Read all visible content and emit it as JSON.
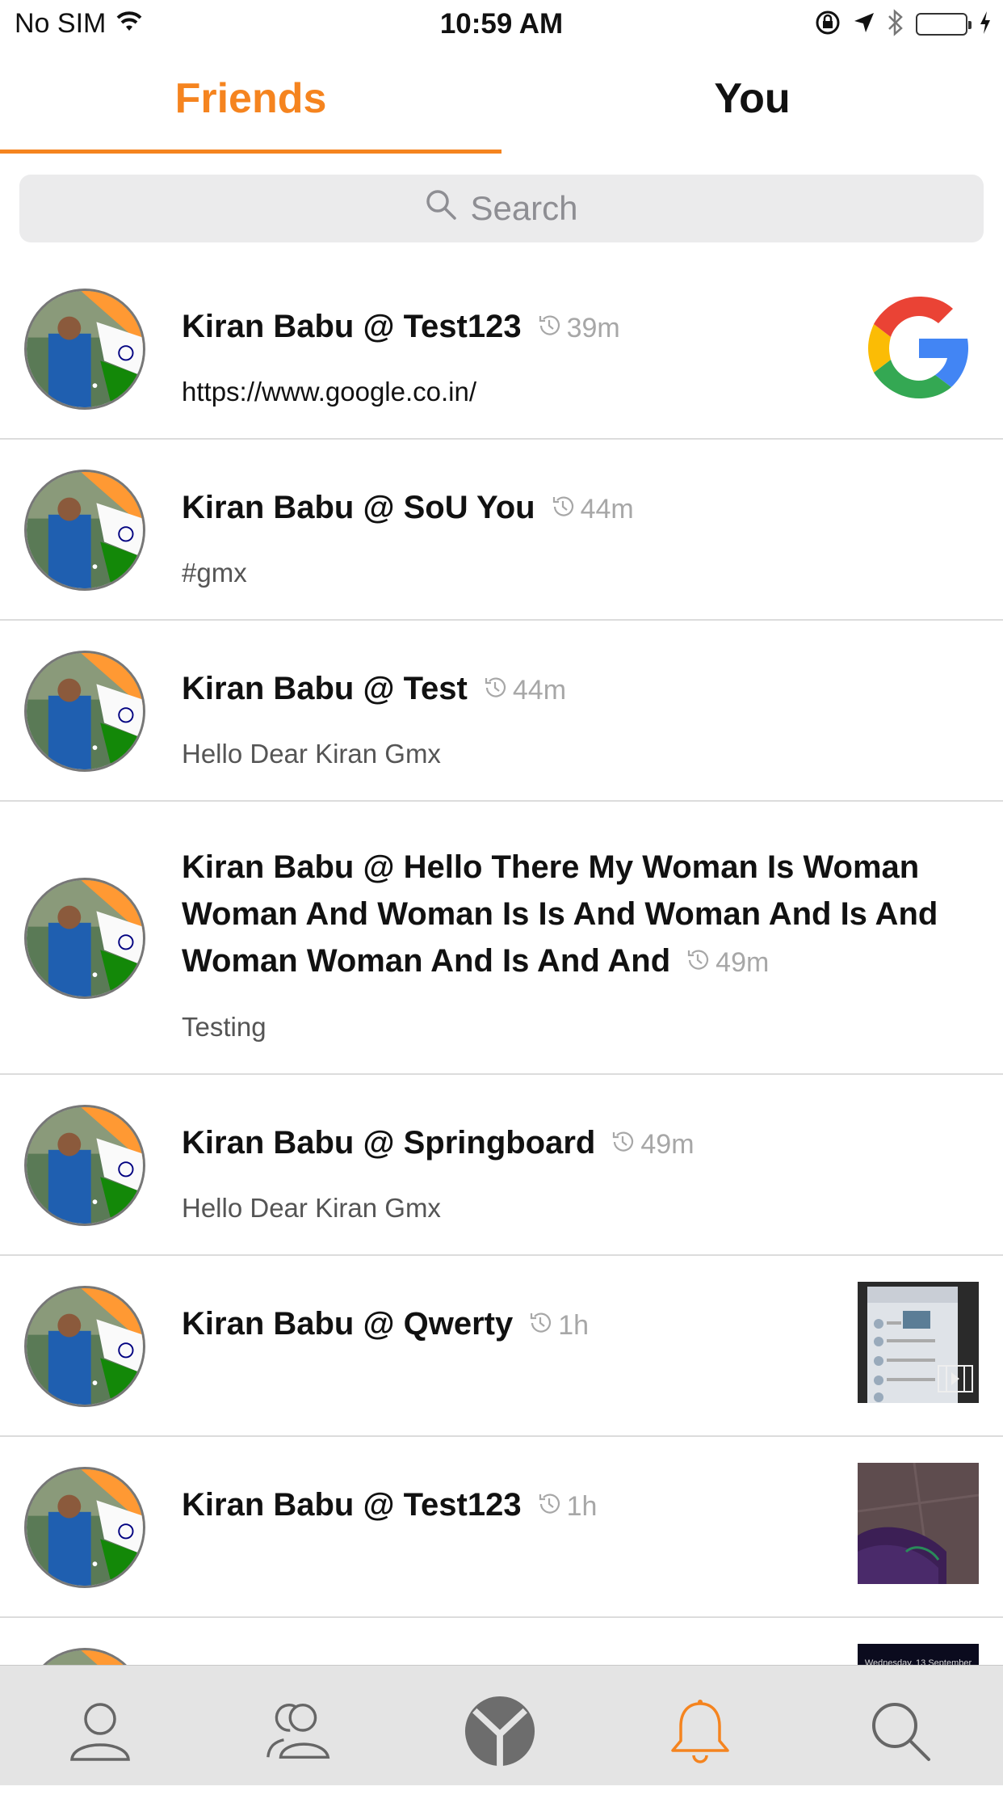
{
  "status_bar": {
    "carrier": "No SIM",
    "time": "10:59 AM",
    "icons": [
      "wifi-icon",
      "orientation-lock-icon",
      "location-arrow-icon",
      "bluetooth-icon",
      "battery-icon",
      "charging-icon"
    ]
  },
  "tabs": [
    {
      "label": "Friends",
      "active": true
    },
    {
      "label": "You",
      "active": false
    }
  ],
  "search": {
    "placeholder": "Search"
  },
  "colors": {
    "accent": "#f5841f",
    "text": "#111111",
    "muted": "#a7a7a7",
    "tabbar_bg": "#e4e4e4"
  },
  "feed": [
    {
      "title": "Kiran Babu @ Test123",
      "time": "39m",
      "subtitle": "https://www.google.co.in/",
      "thumbnail": "google-logo"
    },
    {
      "title": "Kiran Babu @ SoU You",
      "time": "44m",
      "subtitle": "#gmx",
      "thumbnail": ""
    },
    {
      "title": "Kiran Babu @ Test",
      "time": "44m",
      "subtitle": "Hello Dear Kiran Gmx",
      "thumbnail": ""
    },
    {
      "title": "Kiran Babu @ Hello There My Woman Is Woman Woman And Woman Is Is And Woman And Is And Woman Woman And Is And And",
      "time": "49m",
      "subtitle": "Testing",
      "thumbnail": ""
    },
    {
      "title": "Kiran Babu @ Springboard",
      "time": "49m",
      "subtitle": "Hello Dear Kiran Gmx",
      "thumbnail": ""
    },
    {
      "title": "Kiran Babu @ Qwerty",
      "time": "1h",
      "subtitle": "",
      "thumbnail": "video-screenshot"
    },
    {
      "title": "Kiran Babu @ Test123",
      "time": "1h",
      "subtitle": "",
      "thumbnail": "photo"
    },
    {
      "title": "",
      "time": "",
      "subtitle": "",
      "thumbnail": "lockscreen",
      "thumbnail_text": "Wednesday, 13 September"
    }
  ],
  "tabbar": [
    {
      "icon": "profile-icon",
      "active": false
    },
    {
      "icon": "friends-icon",
      "active": false
    },
    {
      "icon": "yeti-logo-icon",
      "active": false
    },
    {
      "icon": "bell-icon",
      "active": true
    },
    {
      "icon": "search-icon",
      "active": false
    }
  ]
}
